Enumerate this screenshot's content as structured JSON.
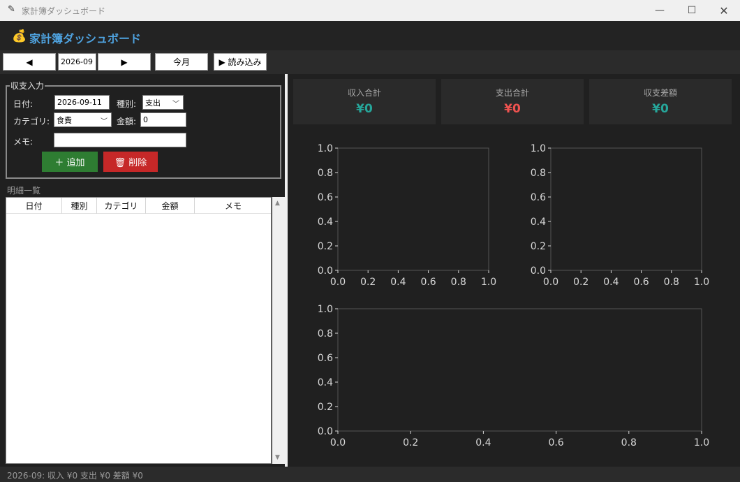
{
  "window": {
    "title": "家計簿ダッシュボード",
    "minimize": "—",
    "maximize": "☐",
    "close": "✕"
  },
  "header": {
    "icon": "money-bag-icon",
    "title": "家計簿ダッシュボード",
    "accent": "#4fa3e0"
  },
  "toolbar": {
    "prev": "◀",
    "month": "2026-09",
    "next": "▶",
    "today": "今月",
    "load": "▶ 読み込み"
  },
  "form": {
    "legend": "収支入力",
    "date_label": "日付:",
    "date_value": "2026-09-11",
    "type_label": "種別:",
    "type_value": "支出",
    "category_label": "カテゴリ:",
    "category_value": "食費",
    "amount_label": "金額:",
    "amount_value": "0",
    "memo_label": "メモ:",
    "memo_value": "",
    "add_label": "＋ 追加",
    "delete_label": "🗑 削除",
    "add_color": "#2e7d32",
    "delete_color": "#c62828"
  },
  "list": {
    "title": "明細一覧",
    "columns": [
      "日付",
      "種別",
      "カテゴリ",
      "金額",
      "メモ"
    ],
    "rows": []
  },
  "summary": [
    {
      "label": "収入合計",
      "value": "¥0",
      "color": "#26a69a"
    },
    {
      "label": "支出合計",
      "value": "¥0",
      "color": "#ef5350"
    },
    {
      "label": "収支差額",
      "value": "¥0",
      "color": "#26a69a"
    }
  ],
  "chart_data": [
    {
      "type": "line",
      "x_ticks": [
        "0.0",
        "0.2",
        "0.4",
        "0.6",
        "0.8",
        "1.0"
      ],
      "y_ticks": [
        "0.0",
        "0.2",
        "0.4",
        "0.6",
        "0.8",
        "1.0"
      ],
      "xlim": [
        0,
        1
      ],
      "ylim": [
        0,
        1
      ],
      "series": []
    },
    {
      "type": "line",
      "x_ticks": [
        "0.0",
        "0.2",
        "0.4",
        "0.6",
        "0.8",
        "1.0"
      ],
      "y_ticks": [
        "0.0",
        "0.2",
        "0.4",
        "0.6",
        "0.8",
        "1.0"
      ],
      "xlim": [
        0,
        1
      ],
      "ylim": [
        0,
        1
      ],
      "series": []
    },
    {
      "type": "line",
      "x_ticks": [
        "0.0",
        "0.2",
        "0.4",
        "0.6",
        "0.8",
        "1.0"
      ],
      "y_ticks": [
        "0.0",
        "0.2",
        "0.4",
        "0.6",
        "0.8",
        "1.0"
      ],
      "xlim": [
        0,
        1
      ],
      "ylim": [
        0,
        1
      ],
      "series": []
    }
  ],
  "status": {
    "text": "2026-09: 収入 ¥0  支出 ¥0  差額 ¥0"
  }
}
